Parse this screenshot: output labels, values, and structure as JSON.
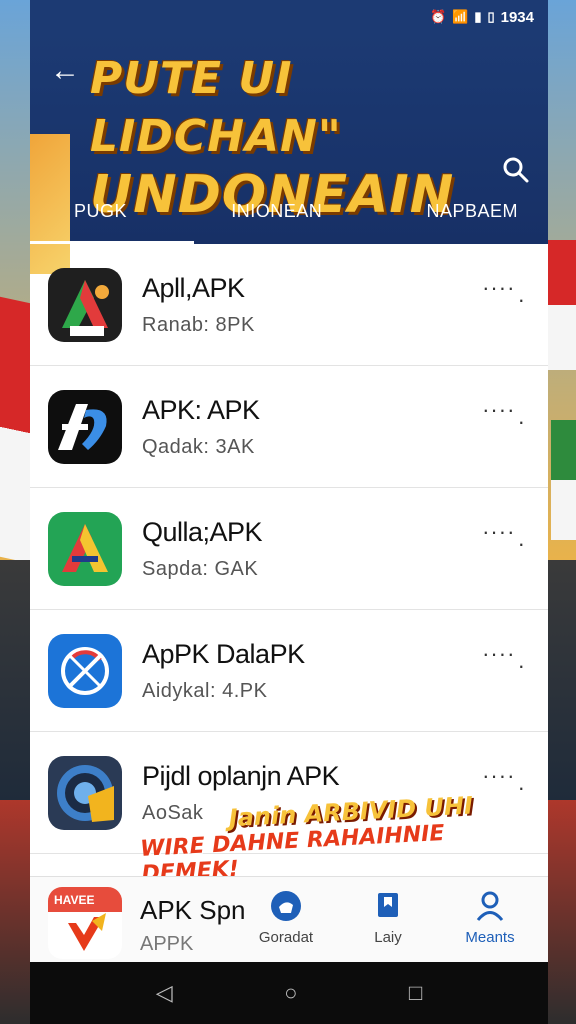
{
  "status_bar": {
    "time": "1934"
  },
  "header": {
    "title_line1": "PUTE UI LIDCHAN\"",
    "title_line2": "UNDONEAIN"
  },
  "tabs": [
    "PUGK",
    "INIONEAN",
    "NAPBAEM"
  ],
  "apps": [
    {
      "name": "Apll,APK",
      "sub": "Ranab:  8PK",
      "icon": "app-a-red-green-icon"
    },
    {
      "name": "APK: APK",
      "sub": "Qadak:  3AK",
      "icon": "app-ap-blue-icon"
    },
    {
      "name": "Qulla;APK",
      "sub": "Sapda:  GAK",
      "icon": "app-a-tricolor-icon"
    },
    {
      "name": "ApPK DalaPK",
      "sub": "Aidykal:  4.PK",
      "icon": "app-compass-icon"
    },
    {
      "name": "Pijdl oplanjn APK",
      "sub": "AoSak",
      "icon": "app-lens-icon"
    }
  ],
  "banner": {
    "line1": "Janin ARBIVID UHI",
    "line2": "WIRE DAHNE RAHAIHNIE DEMEK!"
  },
  "featured": {
    "name": "APK Spn",
    "sub": "APPK",
    "icon_label": "HAVEE"
  },
  "bottom_nav": [
    {
      "label": "Goradat",
      "icon": "thumb-badge-icon"
    },
    {
      "label": "Laiy",
      "icon": "bookmark-icon"
    },
    {
      "label": "Meants",
      "icon": "person-icon"
    }
  ],
  "colors": {
    "header_bg": "#1c3a73",
    "title_yellow": "#f7c23a",
    "accent_blue": "#1e5fb8"
  }
}
